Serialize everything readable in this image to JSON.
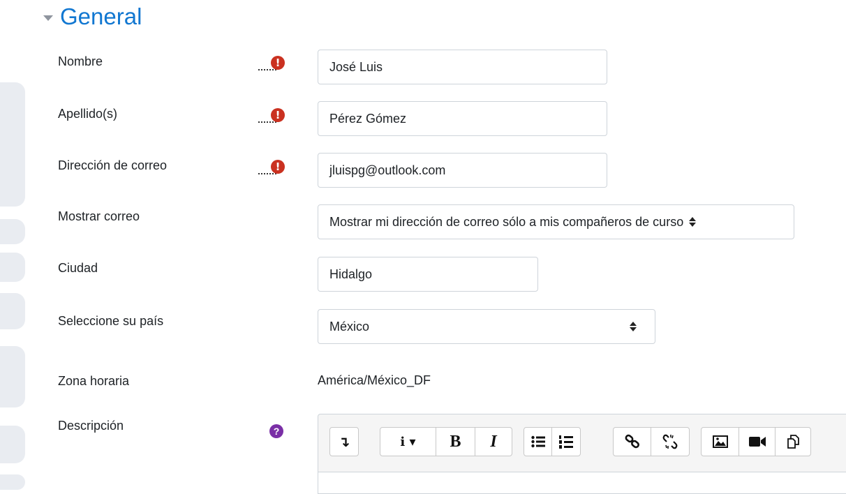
{
  "section": {
    "title": "General"
  },
  "fields": {
    "nombre": {
      "label": "Nombre",
      "value": "José Luis"
    },
    "apellido": {
      "label": "Apellido(s)",
      "value": "Pérez Gómez"
    },
    "correo": {
      "label": "Dirección de correo",
      "value": "jluispg@outlook.com"
    },
    "mostrar": {
      "label": "Mostrar correo",
      "value": "Mostrar mi dirección de correo sólo a mis compañeros de curso"
    },
    "ciudad": {
      "label": "Ciudad",
      "value": "Hidalgo"
    },
    "pais": {
      "label": "Seleccione su país",
      "value": "México"
    },
    "zona": {
      "label": "Zona horaria",
      "value": "América/México_DF"
    },
    "descripcion": {
      "label": "Descripción"
    }
  },
  "icons": {
    "required": "exclamation-circle-icon",
    "help": "question-circle-icon",
    "required_color": "#ca3120",
    "help_color": "#7a2fa6",
    "accent": "#1177d1"
  },
  "toolbar": {
    "show_more": "↴",
    "info": "i ▾",
    "bold": "B",
    "italic": "I"
  }
}
